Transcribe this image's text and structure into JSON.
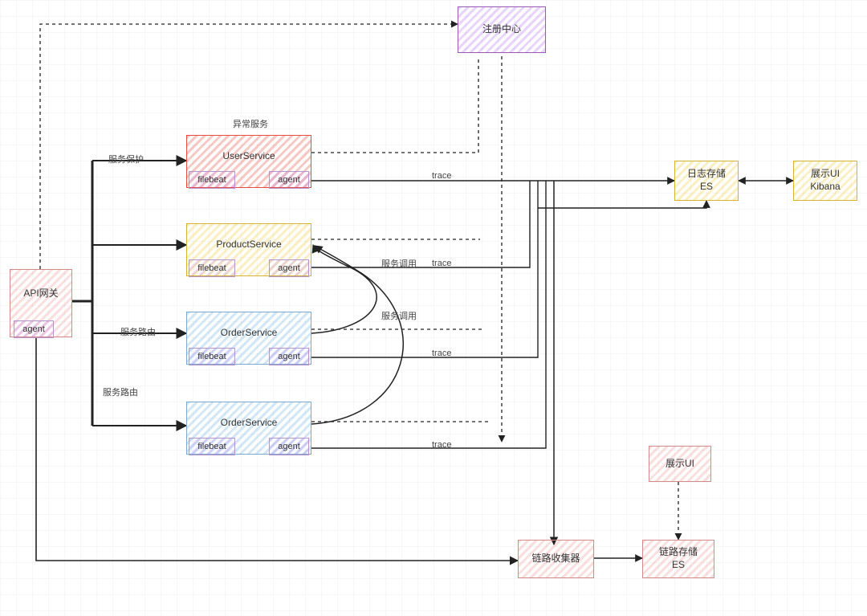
{
  "nodes": {
    "registry": {
      "label": "注册中心"
    },
    "apiGateway": {
      "label": "API网关",
      "agent": "agent"
    },
    "userService": {
      "label": "UserService",
      "filebeat": "filebeat",
      "agent": "agent",
      "caption": "异常服务"
    },
    "productService": {
      "label": "ProductService",
      "filebeat": "filebeat",
      "agent": "agent"
    },
    "orderService1": {
      "label": "OrderService",
      "filebeat": "filebeat",
      "agent": "agent"
    },
    "orderService2": {
      "label": "OrderService",
      "filebeat": "filebeat",
      "agent": "agent"
    },
    "logStore": {
      "label": "日志存储\nES"
    },
    "showUiKibana": {
      "label": "展示UI\nKibana"
    },
    "showUi": {
      "label": "展示UI"
    },
    "traceCollector": {
      "label": "链路收集器"
    },
    "traceStore": {
      "label": "链路存储\nES"
    }
  },
  "edgeLabels": {
    "serviceProtect": "服务保护",
    "serviceRoute1": "服务路由",
    "serviceRoute2": "服务路由",
    "serviceCall1": "服务调用",
    "serviceCall2": "服务调用",
    "trace1": "trace",
    "trace2": "trace",
    "trace3": "trace",
    "trace4": "trace"
  }
}
